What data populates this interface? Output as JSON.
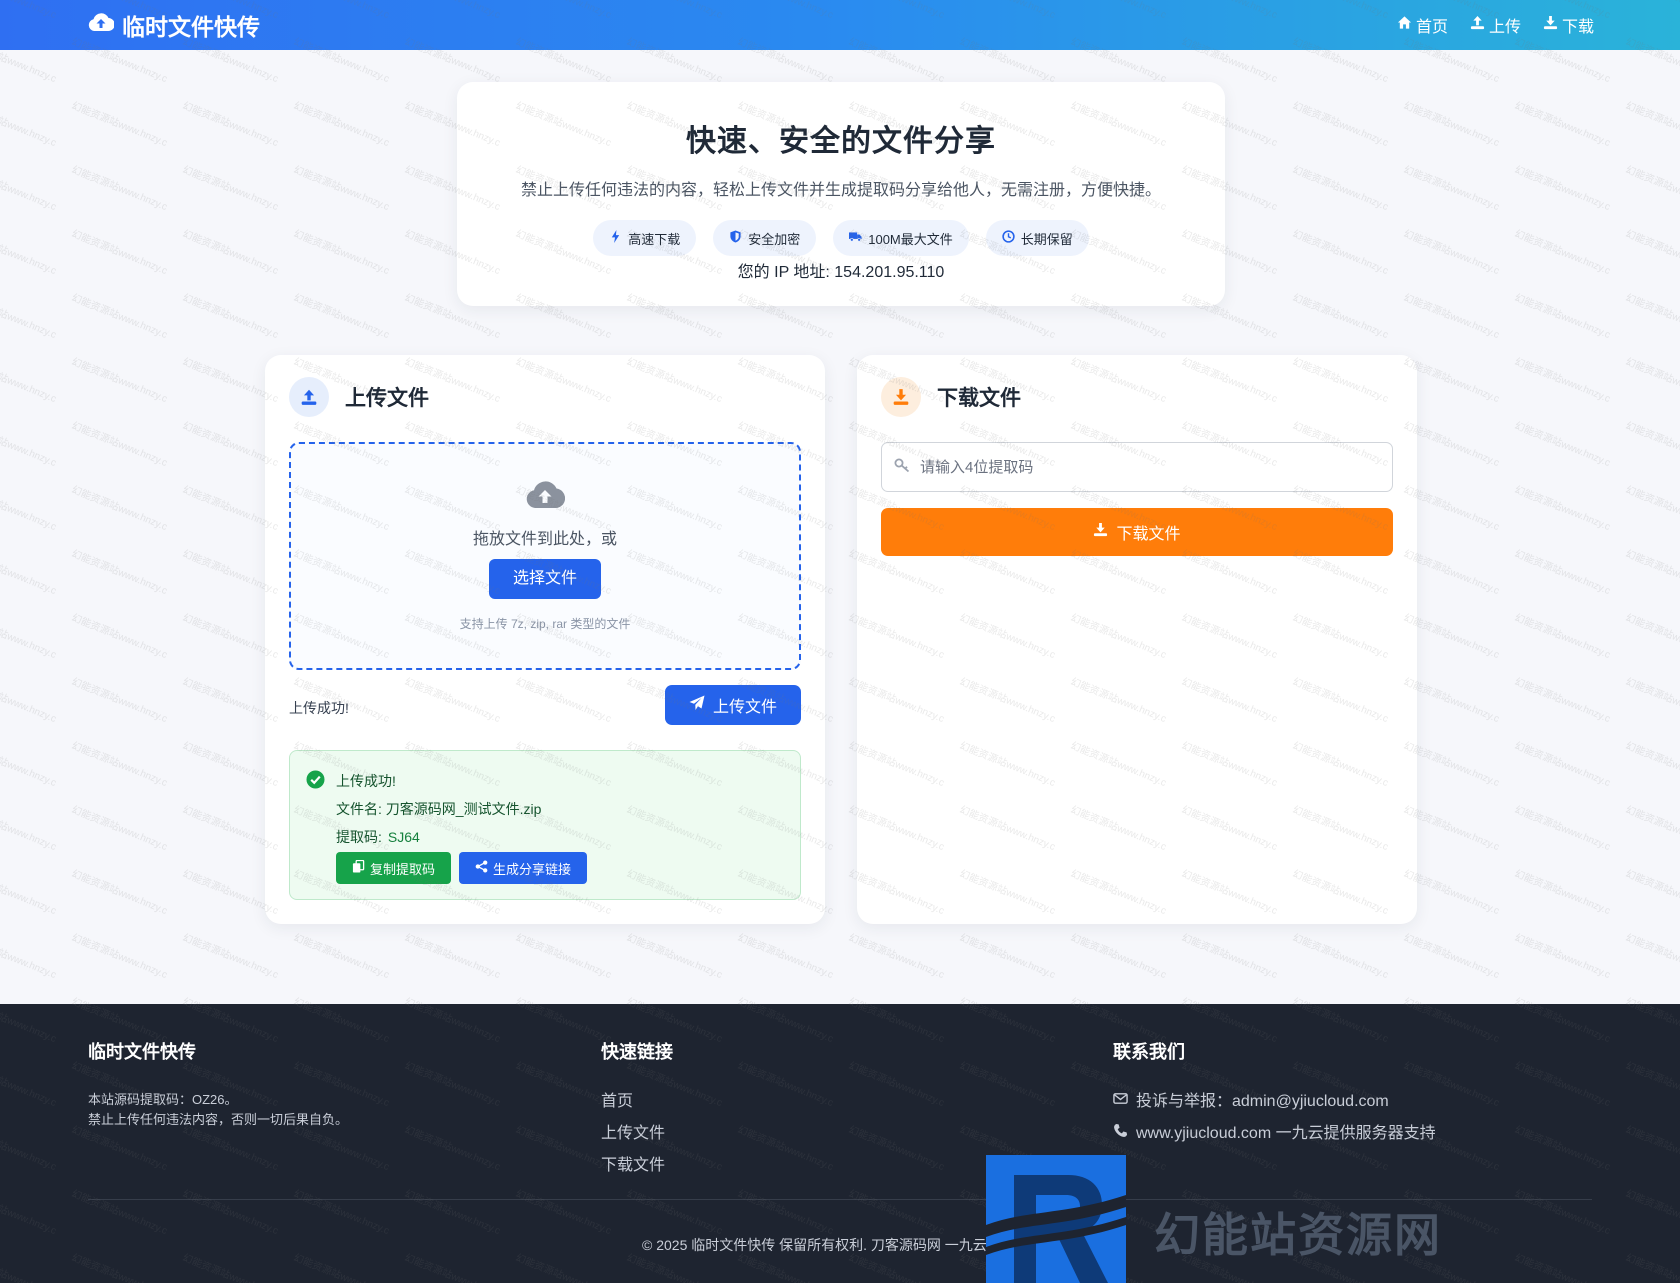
{
  "nav": {
    "brand": "临时文件快传",
    "links": [
      {
        "label": "首页",
        "icon": "home-icon"
      },
      {
        "label": "上传",
        "icon": "upload-icon"
      },
      {
        "label": "下载",
        "icon": "download-icon"
      }
    ]
  },
  "hero": {
    "title": "快速、安全的文件分享",
    "subtitle": "禁止上传任何违法的内容，轻松上传文件并生成提取码分享给他人，无需注册，方便快捷。",
    "features": [
      {
        "label": "高速下载",
        "icon": "bolt-icon"
      },
      {
        "label": "安全加密",
        "icon": "shield-icon"
      },
      {
        "label": "100M最大文件",
        "icon": "truck-icon"
      },
      {
        "label": "长期保留",
        "icon": "clock-icon"
      }
    ],
    "ip_text": "您的 IP 地址: 154.201.95.110"
  },
  "upload": {
    "title": "上传文件",
    "drop_text": "拖放文件到此处，或",
    "choose_label": "选择文件",
    "hint": "支持上传 7z, zip, rar 类型的文件",
    "status": "上传成功!",
    "upload_button": "上传文件",
    "result": {
      "heading": "上传成功!",
      "filename_label": "文件名: 刀客源码网_测试文件.zip",
      "code_label": "提取码:",
      "code": "SJ64",
      "copy_button": "复制提取码",
      "share_button": "生成分享链接"
    }
  },
  "download": {
    "title": "下载文件",
    "placeholder": "请输入4位提取码",
    "value": "",
    "button": "下载文件"
  },
  "footer": {
    "col1_title": "临时文件快传",
    "col1_lines": [
      "本站源码提取码：OZ26。",
      "禁止上传任何违法内容，否则一切后果自负。"
    ],
    "col2_title": "快速链接",
    "col2_links": [
      "首页",
      "上传文件",
      "下载文件"
    ],
    "col3_title": "联系我们",
    "contact_email": "投诉与举报：admin@yjiucloud.com",
    "contact_site": "www.yjiucloud.com 一九云提供服务器支持",
    "copyright": "© 2025 临时文件快传 保留所有权利. 刀客源码网 一九云"
  },
  "overlay": {
    "watermark_text": "幻能资源站www.hnzy.c",
    "logo_text": "幻能站资源网"
  },
  "colors": {
    "primary": "#2563eb",
    "orange": "#ff7d0a",
    "success": "#16a34a",
    "footer_bg": "#1e2430"
  }
}
